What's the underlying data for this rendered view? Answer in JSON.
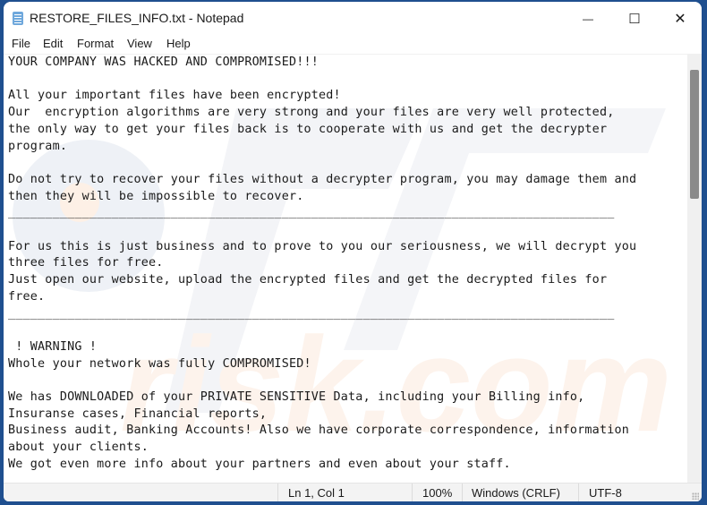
{
  "window": {
    "title": "RESTORE_FILES_INFO.txt - Notepad",
    "app_icon": "notepad-icon",
    "controls": {
      "minimize": "—",
      "maximize": "☐",
      "close": "✕"
    }
  },
  "menu": {
    "items": [
      {
        "label": "File"
      },
      {
        "label": "Edit"
      },
      {
        "label": "Format"
      },
      {
        "label": "View"
      },
      {
        "label": "Help"
      }
    ]
  },
  "document": {
    "content": "YOUR COMPANY WAS HACKED AND COMPROMISED!!!\n\nAll your important files have been encrypted!\nOur  encryption algorithms are very strong and your files are very well protected,\nthe only way to get your files back is to cooperate with us and get the decrypter\nprogram.\n\nDo not try to recover your files without a decrypter program, you may damage them and\nthen they will be impossible to recover.\n__________________________________________________________________________________\n\nFor us this is just business and to prove to you our seriousness, we will decrypt you\nthree files for free.\nJust open our website, upload the encrypted files and get the decrypted files for\nfree.\n__________________________________________________________________________________\n\n ! WARNING !\nWhole your network was fully COMPROMISED!\n\nWe has DOWNLOADED of your PRIVATE SENSITIVE Data, including your Billing info,\nInsuranse cases, Financial reports,\nBusiness audit, Banking Accounts! Also we have corporate correspondence, information\nabout your clients.\nWe got even more info about your partners and even about your staff."
  },
  "status": {
    "position": "Ln 1, Col 1",
    "zoom": "100%",
    "line_ending": "Windows (CRLF)",
    "encoding": "UTF-8"
  },
  "scroll": {
    "position_fraction": 0.0
  }
}
